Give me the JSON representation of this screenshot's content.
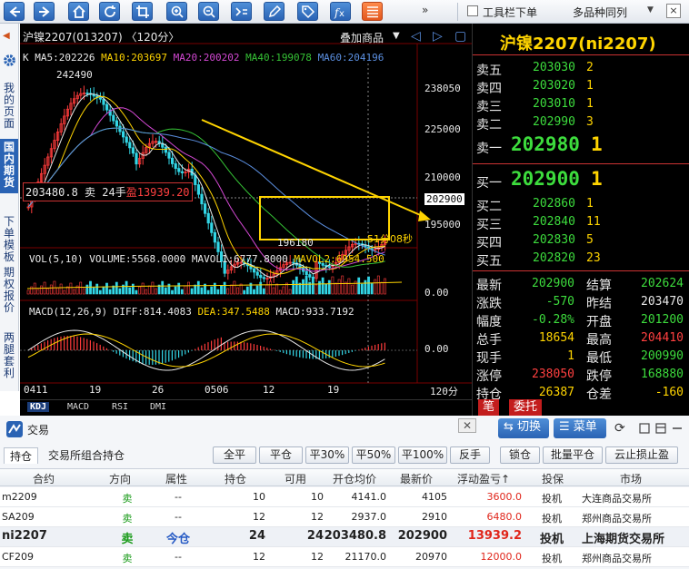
{
  "toolbar": {
    "buttons": [
      "back-arrow-icon",
      "forward-arrow-icon",
      "home-icon",
      "refresh-icon",
      "crop-icon",
      "zoom-in-icon",
      "zoom-out-icon",
      "formula-icon",
      "pencil-icon",
      "tag-icon",
      "fx-icon",
      "list-icon"
    ],
    "more": "»",
    "checkbox_label": "工具栏下单",
    "variety_select": "多品种同列",
    "close": "×"
  },
  "sidebar": {
    "items": [
      {
        "label": "我的页面"
      },
      {
        "label": "国内期货",
        "active": true
      },
      {
        "label": "下单模板"
      },
      {
        "label": "期权报价"
      },
      {
        "label": "两腿套利"
      }
    ]
  },
  "chart": {
    "title": "沪镍2207(013207) 〈120分〉",
    "overlay_label": "叠加商品",
    "ma": {
      "prefix": "K",
      "items": [
        {
          "text": "MA5:202226",
          "color": "#e8e8e8"
        },
        {
          "text": "MA10:203697",
          "color": "#ffd400"
        },
        {
          "text": "MA20:200202",
          "color": "#d248d2"
        },
        {
          "text": "MA40:199078",
          "color": "#35c235"
        },
        {
          "text": "MA60:204196",
          "color": "#5b8fe0"
        }
      ]
    },
    "peak_label": "242490",
    "low_label": "196180",
    "position_label": {
      "price": "203480.8",
      "side": "卖",
      "qty": "24手",
      "pnl": "盈13939.20"
    },
    "countdown": "51分08秒",
    "y_ticks": [
      "238050",
      "225000",
      "210000",
      "202900",
      "195000"
    ],
    "volume": {
      "label": "VOL(5,10)",
      "items": [
        {
          "text": "VOLUME:5568.0000",
          "color": "#e8e8e8"
        },
        {
          "text": "MAVOL1:6777.8000",
          "color": "#e8e8e8"
        },
        {
          "text": "MAVOL2:6954.500",
          "color": "#ffd400"
        }
      ],
      "y_tick": "0.00"
    },
    "macd": {
      "label": "MACD(12,26,9)",
      "items": [
        {
          "text": "DIFF:814.4083",
          "color": "#e8e8e8"
        },
        {
          "text": "DEA:347.5488",
          "color": "#ffd400"
        },
        {
          "text": "MACD:933.7192",
          "color": "#e8e8e8"
        }
      ],
      "y_tick": "0.00"
    },
    "x_ticks": [
      "0411",
      "19",
      "26",
      "0506",
      "12",
      "19"
    ],
    "period": "120分",
    "indicator_tabs": [
      "KDJ",
      "MACD",
      "RSI",
      "DMI"
    ]
  },
  "chart_data": {
    "type": "candlestick",
    "symbol": "沪镍2207(013207)",
    "period": "120分",
    "x_ticks": [
      "0411",
      "19",
      "26",
      "0506",
      "12",
      "19"
    ],
    "y_ticks": [
      238050,
      225000,
      210000,
      202900,
      195000
    ],
    "peak": 242490,
    "low": 196180,
    "last": 202900,
    "ma": {
      "MA5": 202226,
      "MA10": 203697,
      "MA20": 200202,
      "MA40": 199078,
      "MA60": 204196
    },
    "volume": {
      "VOLUME": 5568.0,
      "MAVOL1": 6777.8,
      "MAVOL2": 6954.5
    },
    "macd": {
      "DIFF": 814.4083,
      "DEA": 347.5488,
      "MACD": 933.7192
    }
  },
  "quote": {
    "title": "沪镍2207(ni2207)",
    "asks": [
      {
        "label": "卖五",
        "price": "203030",
        "vol": "2"
      },
      {
        "label": "卖四",
        "price": "203020",
        "vol": "1"
      },
      {
        "label": "卖三",
        "price": "203010",
        "vol": "1"
      },
      {
        "label": "卖二",
        "price": "202990",
        "vol": "3"
      }
    ],
    "ask1": {
      "label": "卖一",
      "price": "202980",
      "vol": "1"
    },
    "bid1": {
      "label": "买一",
      "price": "202900",
      "vol": "1"
    },
    "bids": [
      {
        "label": "买二",
        "price": "202860",
        "vol": "1"
      },
      {
        "label": "买三",
        "price": "202840",
        "vol": "11"
      },
      {
        "label": "买四",
        "price": "202830",
        "vol": "5"
      },
      {
        "label": "买五",
        "price": "202820",
        "vol": "23"
      }
    ],
    "stats": [
      {
        "l1": "最新",
        "v1": "202900",
        "c1": "green",
        "l2": "结算",
        "v2": "202624",
        "c2": "green"
      },
      {
        "l1": "涨跌",
        "v1": "-570",
        "c1": "green",
        "l2": "昨结",
        "v2": "203470",
        "c2": "white"
      },
      {
        "l1": "幅度",
        "v1": "-0.28%",
        "c1": "green",
        "l2": "开盘",
        "v2": "201200",
        "c2": "green"
      },
      {
        "l1": "总手",
        "v1": "18654",
        "c1": "yellow",
        "l2": "最高",
        "v2": "204410",
        "c2": "red"
      },
      {
        "l1": "现手",
        "v1": "1",
        "c1": "yellow",
        "l2": "最低",
        "v2": "200990",
        "c2": "green"
      },
      {
        "l1": "涨停",
        "v1": "238050",
        "c1": "red",
        "l2": "跌停",
        "v2": "168880",
        "c2": "green"
      },
      {
        "l1": "持仓",
        "v1": "26387",
        "c1": "yellow",
        "l2": "仓差",
        "v2": "-160",
        "c2": "yellow"
      }
    ],
    "tabs": [
      "笔",
      "委托"
    ]
  },
  "order": {
    "title": "交易",
    "close": "✕",
    "switch_label": "切换",
    "menu_label": "菜单",
    "refresh": "⟳",
    "position_tabs": [
      "持仓",
      "交易所组合持仓"
    ],
    "action_buttons": [
      "全平",
      "平仓",
      "平30%",
      "平50%",
      "平100%",
      "反手",
      "锁仓",
      "批量平仓",
      "云止损止盈"
    ],
    "columns": [
      "合约",
      "方向",
      "属性",
      "持仓",
      "可用",
      "开仓均价",
      "最新价",
      "浮动盈亏↑",
      "投保",
      "市场"
    ],
    "rows": [
      {
        "contract": "m2209",
        "dir": "卖",
        "attr": "--",
        "pos": "10",
        "avail": "10",
        "avg": "4141.0",
        "last": "4105",
        "pnl": "3600.0",
        "hedge": "投机",
        "market": "大连商品交易所"
      },
      {
        "contract": "SA209",
        "dir": "卖",
        "attr": "--",
        "pos": "12",
        "avail": "12",
        "avg": "2937.0",
        "last": "2910",
        "pnl": "6480.0",
        "hedge": "投机",
        "market": "郑州商品交易所"
      },
      {
        "contract": "ni2207",
        "dir": "卖",
        "attr": "今仓",
        "pos": "24",
        "avail": "24",
        "avg": "203480.8",
        "last": "202900",
        "pnl": "13939.2",
        "hedge": "投机",
        "market": "上海期货交易所"
      },
      {
        "contract": "CF209",
        "dir": "卖",
        "attr": "--",
        "pos": "12",
        "avail": "12",
        "avg": "21170.0",
        "last": "20970",
        "pnl": "12000.0",
        "hedge": "投机",
        "market": "郑州商品交易所"
      }
    ]
  }
}
